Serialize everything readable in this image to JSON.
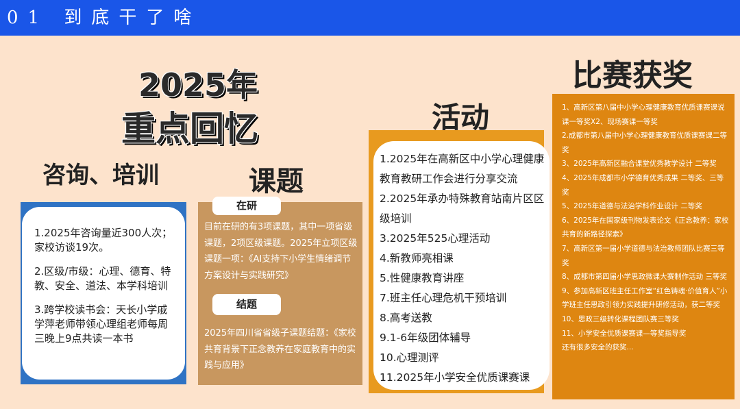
{
  "header": {
    "title": "01 到底干了啥"
  },
  "main_title": {
    "line1": "2025年",
    "line2": "重点回忆"
  },
  "consult": {
    "heading": "咨询、培训",
    "items": [
      "1.2025年咨询量近300人次；家校访谈19次。",
      "2.区级/市级：心理、德育、特教、安全、道法、本学科培训",
      "3.跨学校读书会：天长小学戚学萍老师带领心理组老师每周三晚上9点共读一本书"
    ]
  },
  "research": {
    "heading": "课题",
    "ongoing_label": "在研",
    "ongoing_text": "目前在研的有3项课题，其中一项省级课题，2项区级课题。2025年立项区级课题一项：《AI支持下小学生情绪调节方案设计与实践研究》",
    "closed_label": "结题",
    "closed_text": "2025年四川省省级子课题结题：《家校共育背景下正念教养在家庭教育中的实践与应用》"
  },
  "activity": {
    "heading": "活动",
    "items": [
      "1.2025年在高新区中小学心理健康教育教研工作会进行分享交流",
      "2.2025年承办特殊教育站南片区区级培训",
      "3.2025年525心理活动",
      "4.新教师亮相课",
      "5.性健康教育讲座",
      "7.班主任心理危机干预培训",
      "8.高考送教",
      "9.1-6年级团体辅导",
      "10.心理测评",
      "11.2025年小学安全优质课赛课"
    ]
  },
  "awards": {
    "heading": "比赛获奖",
    "items": [
      "1、高新区第八届中小学心理健康教育优质课赛课说课一等奖X2、现场赛课一等奖",
      "2.成都市第八届中小学心理健康教育优质课赛课二等奖",
      "3、2025年高新区融合课堂优秀教学设计 二等奖",
      "4、2025年成都市小学德育优秀成果 二等奖、三等奖",
      "5、2025年道德与法治学科作业设计 二等奖",
      "6、2025年在国家级刊物发表论文《正念教养：家校共育的新路径探索》",
      "7、高新区第一届小学道德与法治教师团队比赛三等奖",
      "8、成都市第四届小学思政微课大赛制作活动 三等奖",
      "9、参加高新区班主任工作室“红色铸魂·价值育人”小学班主任思政引领力实践提升研修活动，获二等奖",
      "10、思政三级转化课程团队赛三等奖",
      "11、小学安全优质课赛课—等奖指导奖",
      "还有很多安全的获奖..."
    ]
  },
  "colors": {
    "header_bg": "#1a56e8",
    "page_bg": "#fde3cc",
    "consult_box": "#2f73c4",
    "research_box": "#c8975f",
    "activity_box": "#e89a1f",
    "awards_box": "#de8611"
  }
}
